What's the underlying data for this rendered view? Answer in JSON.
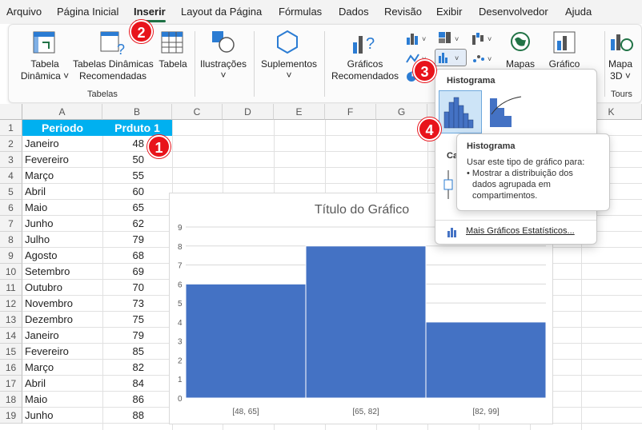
{
  "menu": {
    "tabs": [
      "Arquivo",
      "Página Inicial",
      "Inserir",
      "Layout da Página",
      "Fórmulas",
      "Dados",
      "Revisão",
      "Exibir",
      "Desenvolvedor",
      "Ajuda"
    ],
    "active": "Inserir"
  },
  "ribbon": {
    "tabela_dinamica": "Tabela\nDinâmica ˅",
    "tabelas_dinamicas_rec": "Tabelas Dinâmicas\nRecomendadas",
    "tabela": "Tabela",
    "tabelas_group": "Tabelas",
    "ilustracoes": "Ilustrações",
    "suplementos": "Suplementos",
    "graficos_recomendados": "Gráficos\nRecomendados",
    "mapas": "Mapas",
    "grafico": "Gráfico",
    "mapa3d": "Mapa\n3D ˅",
    "tours_group": "Tours"
  },
  "sheet": {
    "columns": [
      "A",
      "B",
      "C",
      "D",
      "E",
      "F",
      "G",
      "H",
      "I",
      "J",
      "K"
    ],
    "rows": [
      "1",
      "2",
      "3",
      "4",
      "5",
      "6",
      "7",
      "8",
      "9",
      "10",
      "11",
      "12",
      "13",
      "14",
      "15",
      "16",
      "17",
      "18",
      "19"
    ],
    "header": {
      "a": "Periodo",
      "b": "Prduto 1"
    },
    "data": [
      {
        "month": "Janeiro",
        "value": "48"
      },
      {
        "month": "Fevereiro",
        "value": "50"
      },
      {
        "month": "Março",
        "value": "55"
      },
      {
        "month": "Abril",
        "value": "60"
      },
      {
        "month": "Maio",
        "value": "65"
      },
      {
        "month": "Junho",
        "value": "62"
      },
      {
        "month": "Julho",
        "value": "79"
      },
      {
        "month": "Agosto",
        "value": "68"
      },
      {
        "month": "Setembro",
        "value": "69"
      },
      {
        "month": "Outubro",
        "value": "70"
      },
      {
        "month": "Novembro",
        "value": "73"
      },
      {
        "month": "Dezembro",
        "value": "75"
      },
      {
        "month": "Janeiro",
        "value": "79"
      },
      {
        "month": "Fevereiro",
        "value": "85"
      },
      {
        "month": "Março",
        "value": "82"
      },
      {
        "month": "Abril",
        "value": "84"
      },
      {
        "month": "Maio",
        "value": "86"
      },
      {
        "month": "Junho",
        "value": "88"
      }
    ]
  },
  "badges": {
    "b1": "1",
    "b2": "2",
    "b3": "3",
    "b4": "4"
  },
  "dropdown": {
    "section1": "Histograma",
    "section2": "Ca",
    "more": "Mais Gráficos Estatísticos..."
  },
  "tooltip": {
    "title": "Histograma",
    "line1": "Usar este tipo de gráfico para:",
    "line2": "• Mostrar a distribuição dos",
    "line3": "dados agrupada em",
    "line4": "compartimentos."
  },
  "colors": {
    "bar": "#4472c4",
    "header": "#00b0f0",
    "badge": "#e8141b",
    "accent": "#1e7145"
  },
  "chart_data": {
    "type": "bar",
    "title": "Título do Gráfico",
    "categories": [
      "[48, 65]",
      "[65, 82]",
      "[82, 99]"
    ],
    "values": [
      6,
      8,
      4
    ],
    "ylim": [
      0,
      9
    ],
    "yticks": [
      "0",
      "1",
      "2",
      "3",
      "4",
      "5",
      "6",
      "7",
      "8",
      "9"
    ],
    "grid": true
  }
}
